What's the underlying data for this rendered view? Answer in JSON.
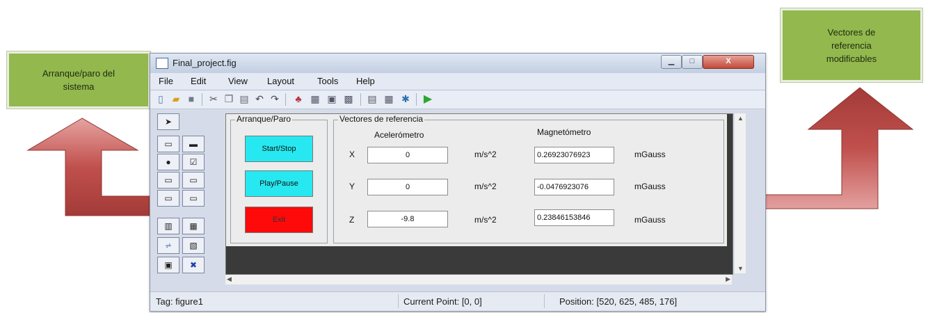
{
  "callouts": {
    "left": [
      "Arranque/paro del",
      "sistema"
    ],
    "right": [
      "Vectores de",
      "referencia",
      "modificables"
    ]
  },
  "window": {
    "title": "Final_project.fig",
    "close_label": "X"
  },
  "menu": [
    "File",
    "Edit",
    "View",
    "Layout",
    "Tools",
    "Help"
  ],
  "toolbar_icons": [
    "new-icon",
    "open-icon",
    "save-icon",
    "cut-icon",
    "copy-icon",
    "paste-icon",
    "undo-icon",
    "redo-icon",
    "align-icon",
    "menu-editor-icon",
    "tab-order-icon",
    "toolbar-editor-icon",
    "mfile-editor-icon",
    "property-inspector-icon",
    "object-browser-icon",
    "run-icon"
  ],
  "palette": [
    "select-tool",
    "pushbutton-tool",
    "slider-tool",
    "radiobutton-tool",
    "checkbox-tool",
    "edit-text-tool",
    "static-text-tool",
    "popup-menu-tool",
    "listbox-tool",
    "togglebutton-tool",
    "table-tool",
    "axes-tool",
    "panel-tool",
    "buttongroup-tool",
    "activex-tool"
  ],
  "gui": {
    "control_panel": {
      "title": "Arranque/Paro",
      "start_stop": "Start/Stop",
      "play_pause": "Play/Pause",
      "exit": "Exit"
    },
    "vectors_panel": {
      "title": "Vectores de referencia",
      "accel_header": "Acelerómetro",
      "mag_header": "Magnetómetro",
      "rows": [
        {
          "axis": "X",
          "accel": "0",
          "accel_unit": "m/s^2",
          "mag": "0.26923076923",
          "mag_unit": "mGauss"
        },
        {
          "axis": "Y",
          "accel": "0",
          "accel_unit": "m/s^2",
          "mag": "-0.0476923076",
          "mag_unit": "mGauss"
        },
        {
          "axis": "Z",
          "accel": "-9.8",
          "accel_unit": "m/s^2",
          "mag": "0.23846153846",
          "mag_unit": "mGauss"
        }
      ]
    }
  },
  "status": {
    "tag": "Tag: figure1",
    "current_point": "Current Point: [0, 0]",
    "position": "Position: [520, 625, 485, 176]"
  },
  "colors": {
    "callout": "#92b84e",
    "arrow": "#c0504d",
    "cyan_button": "#27e8f0",
    "exit_button": "#ff0a0a",
    "canvas": "#3a3a3a"
  }
}
